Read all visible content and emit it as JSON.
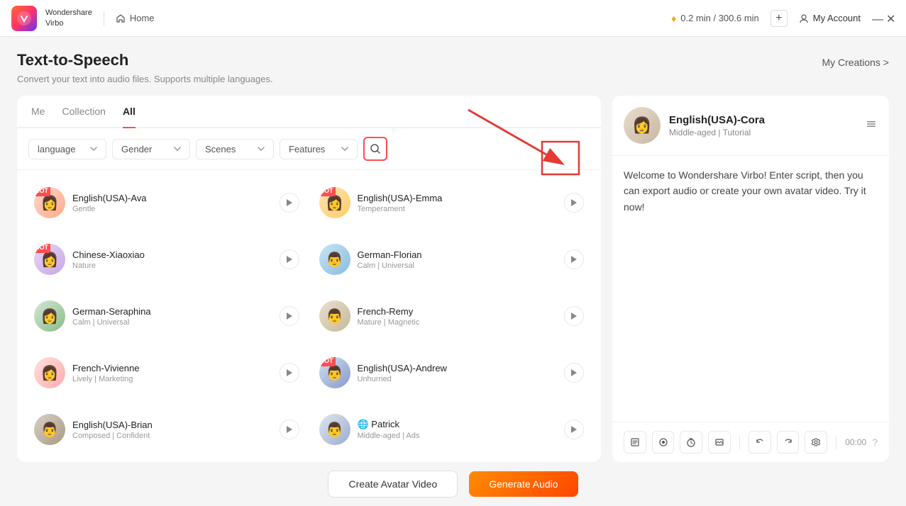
{
  "titleBar": {
    "appName": "Wondershare\nVirbo",
    "homeLabel": "Home",
    "credits": "0.2 min / 300.6 min",
    "accountLabel": "My Account"
  },
  "pageHeader": {
    "title": "Text-to-Speech",
    "subtitle": "Convert your text into audio files. Supports multiple languages.",
    "myCreationsLabel": "My Creations >"
  },
  "tabs": {
    "me": "Me",
    "collection": "Collection",
    "all": "All"
  },
  "filters": {
    "language": "language",
    "gender": "Gender",
    "scenes": "Scenes",
    "features": "Features"
  },
  "voices": [
    {
      "id": "ava",
      "name": "English(USA)-Ava",
      "tags": "Gentle",
      "hot": true,
      "avatarClass": "avatar-ava",
      "col": 0
    },
    {
      "id": "emma",
      "name": "English(USA)-Emma",
      "tags": "Temperament",
      "hot": true,
      "avatarClass": "avatar-emma",
      "col": 1
    },
    {
      "id": "xiaoxiao",
      "name": "Chinese-Xiaoxiao",
      "tags": "Nature",
      "hot": true,
      "avatarClass": "avatar-xiaoxiao",
      "col": 0
    },
    {
      "id": "florian",
      "name": "German-Florian",
      "tags": "Calm | Universal",
      "hot": false,
      "avatarClass": "avatar-florian",
      "col": 1
    },
    {
      "id": "seraphina",
      "name": "German-Seraphina",
      "tags": "Calm | Universal",
      "hot": false,
      "avatarClass": "avatar-seraphina",
      "col": 0
    },
    {
      "id": "remy",
      "name": "French-Remy",
      "tags": "Mature | Magnetic",
      "hot": false,
      "avatarClass": "avatar-remy",
      "col": 1
    },
    {
      "id": "vivienne",
      "name": "French-Vivienne",
      "tags": "Lively | Marketing",
      "hot": false,
      "avatarClass": "avatar-vivienne",
      "col": 0
    },
    {
      "id": "andrew",
      "name": "English(USA)-Andrew",
      "tags": "Unhurried",
      "hot": true,
      "avatarClass": "avatar-andrew",
      "col": 1
    },
    {
      "id": "brian",
      "name": "English(USA)-Brian",
      "tags": "Composed | Confident",
      "hot": false,
      "avatarClass": "avatar-brian",
      "col": 0
    },
    {
      "id": "patrick",
      "name": "Patrick",
      "tags": "Middle-aged | Ads",
      "hot": false,
      "avatarClass": "avatar-patrick",
      "col": 1,
      "globe": true
    }
  ],
  "selectedVoice": {
    "name": "English(USA)-Cora",
    "tags": "Middle-aged | Tutorial",
    "avatarClass": "avatar-cora",
    "scriptText": "Welcome to Wondershare Virbo! Enter script, then you can export audio or create your own avatar video. Try it now!"
  },
  "toolbar": {
    "timeDisplay": "00:00"
  },
  "bottomBar": {
    "avatarBtn": "Create Avatar Video",
    "generateBtn": "Generate Audio"
  }
}
